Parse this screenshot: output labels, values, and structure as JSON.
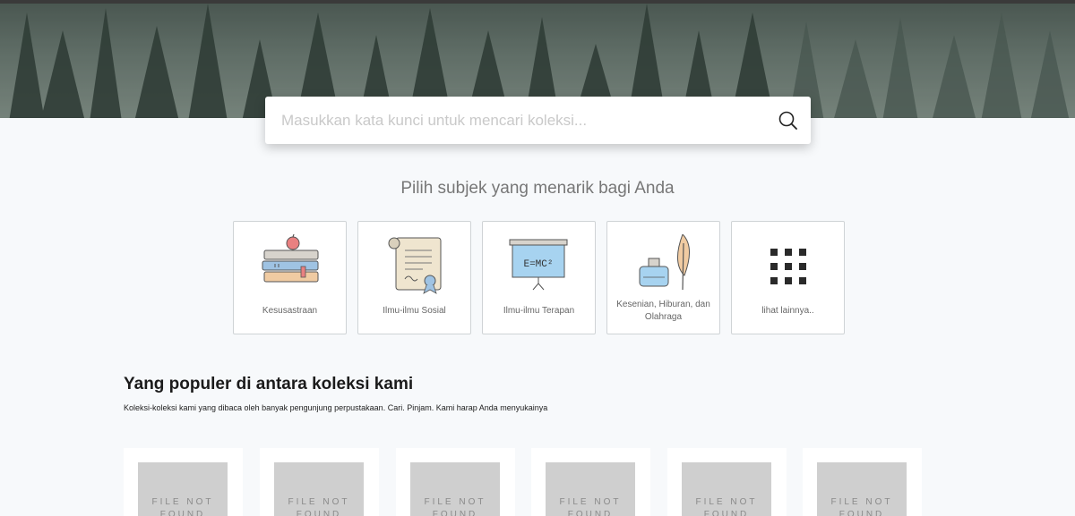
{
  "search": {
    "placeholder": "Masukkan kata kunci untuk mencari koleksi..."
  },
  "subjects": {
    "title": "Pilih subjek yang menarik bagi Anda",
    "items": [
      {
        "label": "Kesusastraan",
        "icon": "books-apple-icon"
      },
      {
        "label": "Ilmu-ilmu Sosial",
        "icon": "certificate-icon"
      },
      {
        "label": "Ilmu-ilmu Terapan",
        "icon": "chalkboard-icon",
        "board_text": "E=MC²"
      },
      {
        "label": "Kesenian, Hiburan, dan Olahraga",
        "icon": "ink-feather-icon"
      },
      {
        "label": "lihat lainnya..",
        "icon": "grid-icon"
      }
    ]
  },
  "popular": {
    "title": "Yang populer di antara koleksi kami",
    "subtitle": "Koleksi-koleksi kami yang dibaca oleh banyak pengunjung perpustakaan. Cari. Pinjam. Kami harap Anda menyukainya",
    "books": [
      {
        "cover_text": "FILE NOT FOUND"
      },
      {
        "cover_text": "FILE NOT FOUND"
      },
      {
        "cover_text": "FILE NOT FOUND"
      },
      {
        "cover_text": "FILE NOT FOUND"
      },
      {
        "cover_text": "FILE NOT FOUND"
      },
      {
        "cover_text": "FILE NOT FOUND"
      }
    ]
  },
  "colors": {
    "background": "#f7f9fb",
    "card_border": "#cfd3d6",
    "cover_placeholder": "#cfcfcf"
  }
}
